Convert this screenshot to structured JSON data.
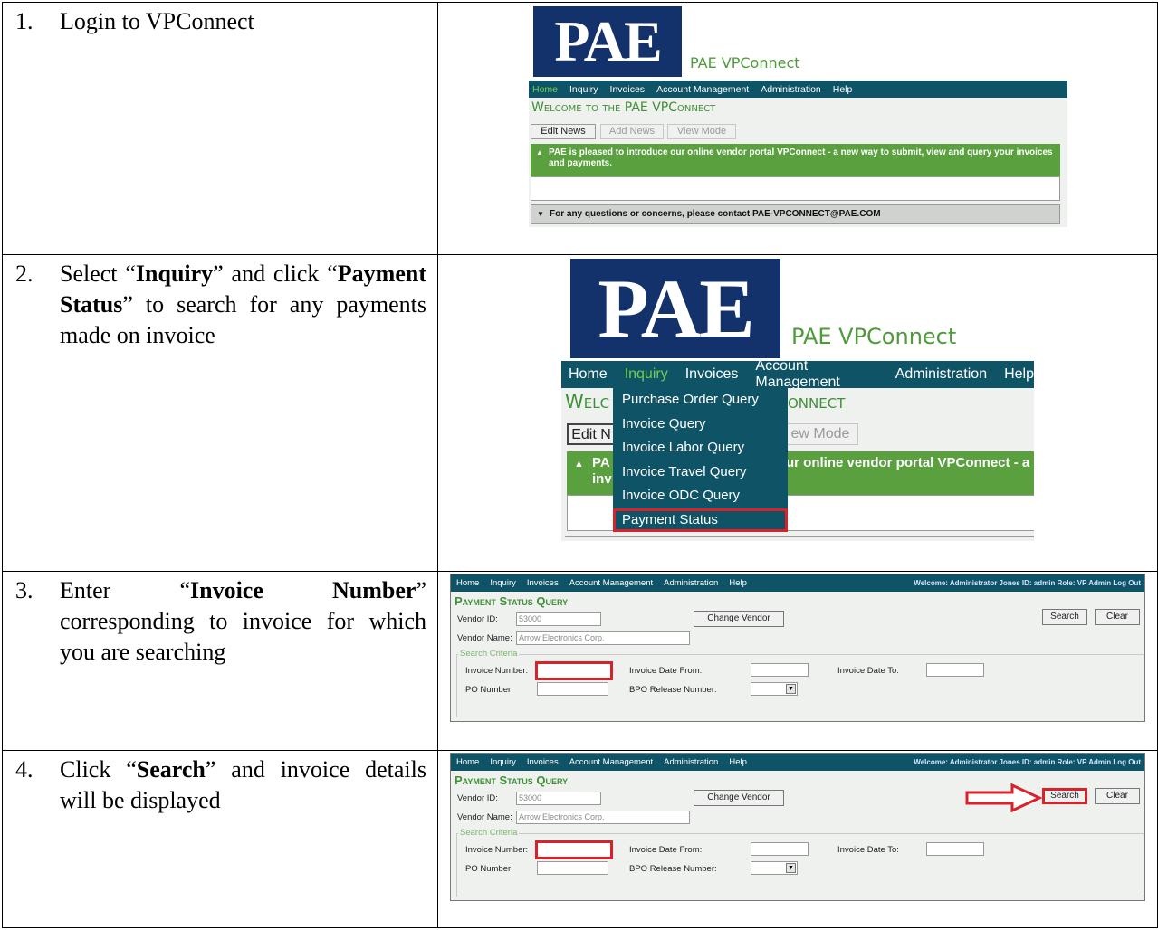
{
  "steps": [
    {
      "num": "1.",
      "pre": "Login to VPConnect"
    },
    {
      "num": "2.",
      "pre": "Select “",
      "b1": "Inquiry",
      "mid": "” and click “",
      "b2": "Payment Status",
      "post": "” to search for any payments made on invoice"
    },
    {
      "num": "3.",
      "pre": "Enter “",
      "b1": "Invoice Number",
      "post": "” corresponding to invoice for which you are searching"
    },
    {
      "num": "4.",
      "pre": "Click “",
      "b1": "Search",
      "post": "” and invoice details will be displayed"
    }
  ],
  "app": {
    "logo": "PAE",
    "portal_title": "PAE VPConnect",
    "nav": [
      "Home",
      "Inquiry",
      "Invoices",
      "Account Management",
      "Administration",
      "Help"
    ],
    "welcome": "Welcome to the PAE VPConnect",
    "welcome_fragment_left": "Welc",
    "welcome_fragment_right": "onnect",
    "buttons": {
      "edit_news": "Edit News",
      "add_news": "Add News",
      "view_mode": "View Mode",
      "edit_fragment": "Edit N",
      "view_fragment": "ew Mode"
    },
    "news": "PAE is pleased to introduce our online vendor portal VPConnect - a new way to submit, view and query your invoices and payments.",
    "news_frag_a": "PA",
    "news_frag_b": "inv",
    "news_frag_right": "ur online vendor portal VPConnect - a",
    "contact": "For any questions or concerns, please contact PAE-VPCONNECT@PAE.COM",
    "inquiry_menu": [
      "Purchase Order Query",
      "Invoice Query",
      "Invoice Labor Query",
      "Invoice Travel Query",
      "Invoice ODC Query",
      "Payment Status"
    ],
    "colors": {
      "navy": "#13316b",
      "teal": "#0f5466",
      "green": "#5aa03f",
      "highlight": "#d8212a"
    }
  },
  "payment_status": {
    "welcome_user": "Welcome: Administrator Jones  ID: admin  Role: VP Admin  Log Out",
    "title": "Payment Status Query",
    "vendor_id_label": "Vendor ID:",
    "vendor_id": "53000",
    "vendor_name_label": "Vendor Name:",
    "vendor_name": "Arrow Electronics Corp.",
    "change_vendor": "Change Vendor",
    "search": "Search",
    "clear": "Clear",
    "criteria": "Search Criteria",
    "invoice_number_label": "Invoice Number:",
    "invoice_date_from_label": "Invoice Date From:",
    "invoice_date_to_label": "Invoice Date To:",
    "po_number_label": "PO Number:",
    "bpo_release_label": "BPO Release Number:"
  }
}
